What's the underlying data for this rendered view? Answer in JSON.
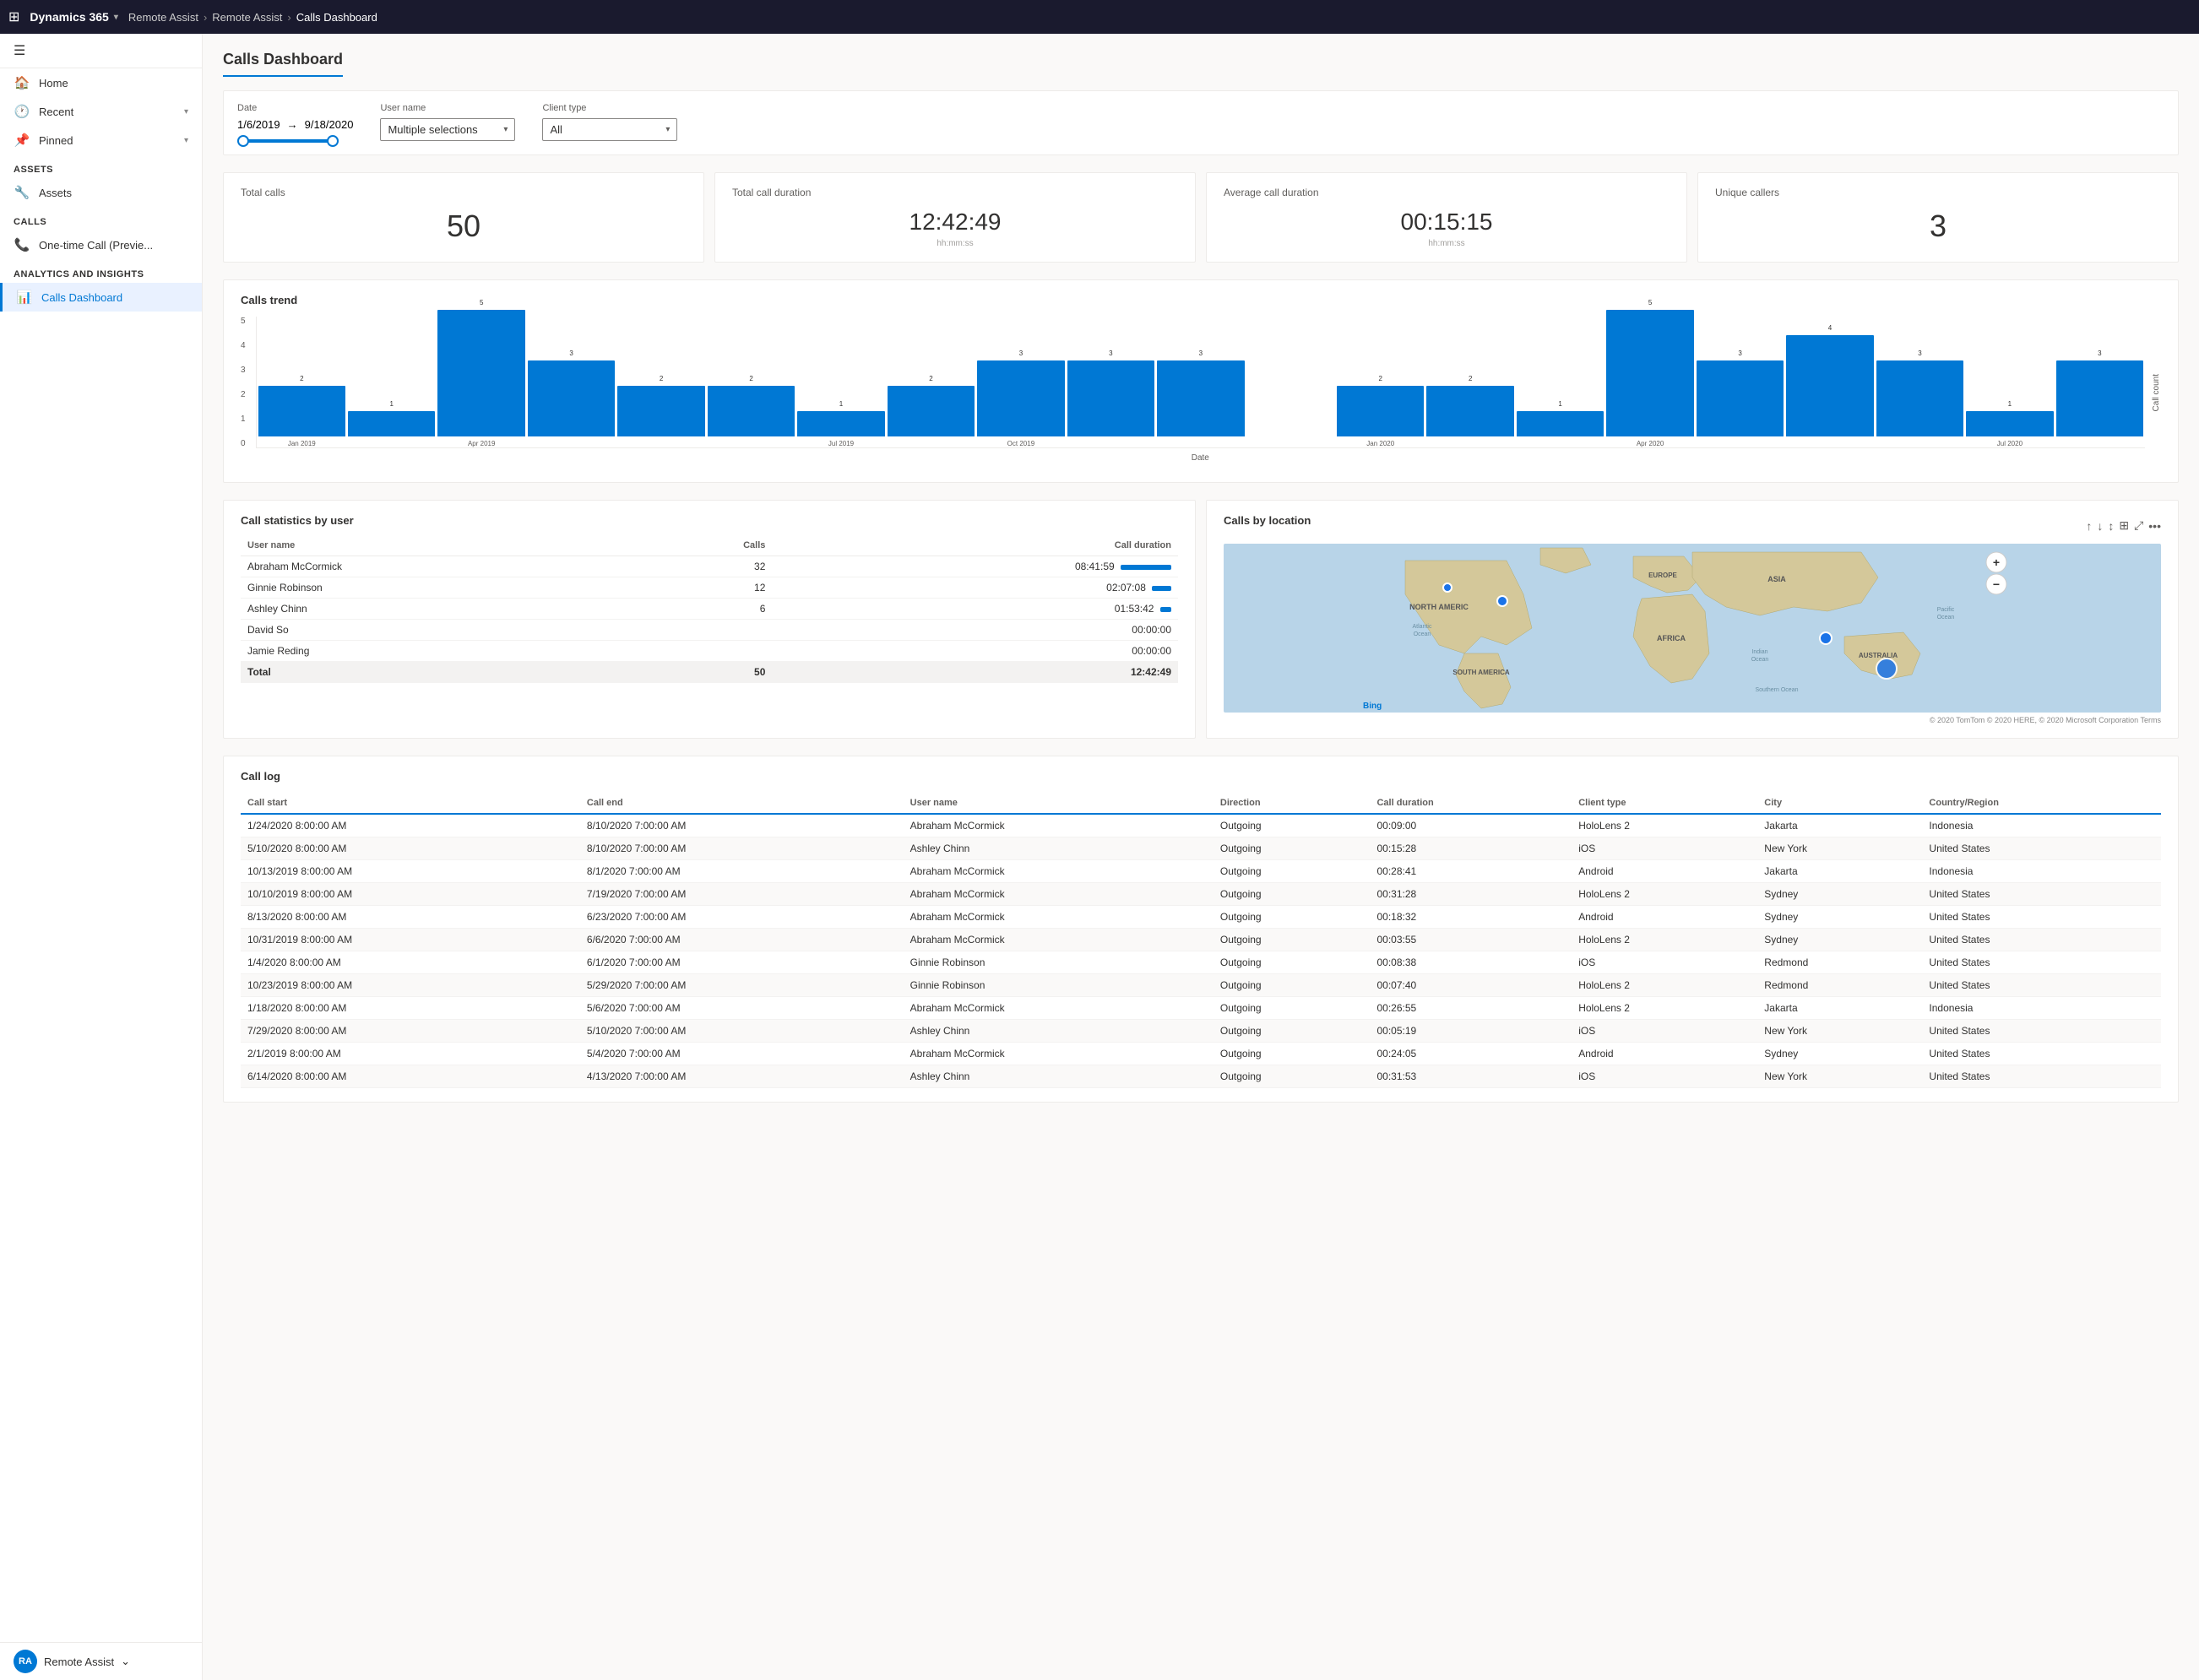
{
  "app": {
    "brand": "Dynamics 365",
    "module": "Remote Assist",
    "breadcrumb1": "Remote Assist",
    "breadcrumb2": "Calls Dashboard"
  },
  "topbar": {
    "waffle": "⊞"
  },
  "sidebar": {
    "hamburger": "☰",
    "items": [
      {
        "id": "home",
        "label": "Home",
        "icon": "🏠"
      },
      {
        "id": "recent",
        "label": "Recent",
        "icon": "🕐",
        "hasChevron": true
      },
      {
        "id": "pinned",
        "label": "Pinned",
        "icon": "📌",
        "hasChevron": true
      }
    ],
    "sections": [
      {
        "header": "Assets",
        "items": [
          {
            "id": "assets",
            "label": "Assets",
            "icon": "🔧"
          }
        ]
      },
      {
        "header": "Calls",
        "items": [
          {
            "id": "one-time-call",
            "label": "One-time Call (Previe...",
            "icon": "📞"
          }
        ]
      },
      {
        "header": "Analytics and Insights",
        "items": [
          {
            "id": "calls-dashboard",
            "label": "Calls Dashboard",
            "icon": "📊",
            "active": true
          }
        ]
      }
    ],
    "footer": {
      "initials": "RA",
      "label": "Remote Assist",
      "chevron": "⌄"
    }
  },
  "page": {
    "title": "Calls Dashboard"
  },
  "filters": {
    "date_label": "Date",
    "date_start": "1/6/2019",
    "date_end": "9/18/2020",
    "username_label": "User name",
    "username_value": "Multiple selections",
    "client_type_label": "Client type",
    "client_type_value": "All"
  },
  "kpis": [
    {
      "title": "Total calls",
      "value": "50",
      "subtitle": ""
    },
    {
      "title": "Total call duration",
      "value": "12:42:49",
      "subtitle": "hh:mm:ss"
    },
    {
      "title": "Average call duration",
      "value": "00:15:15",
      "subtitle": "hh:mm:ss"
    },
    {
      "title": "Unique callers",
      "value": "3",
      "subtitle": ""
    }
  ],
  "calls_trend": {
    "title": "Calls trend",
    "y_label": "Call count",
    "x_label": "Date",
    "y_ticks": [
      5,
      4,
      3,
      2,
      1,
      0
    ],
    "bars": [
      {
        "month": "Jan 2019",
        "value": 2
      },
      {
        "month": "",
        "value": 1
      },
      {
        "month": "Apr 2019",
        "value": 5
      },
      {
        "month": "",
        "value": 3
      },
      {
        "month": "",
        "value": 2
      },
      {
        "month": "",
        "value": 2
      },
      {
        "month": "Jul 2019",
        "value": 1
      },
      {
        "month": "",
        "value": 2
      },
      {
        "month": "Oct 2019",
        "value": 3
      },
      {
        "month": "",
        "value": 3
      },
      {
        "month": "",
        "value": 3
      },
      {
        "month": "",
        "value": 0
      },
      {
        "month": "Jan 2020",
        "value": 2
      },
      {
        "month": "",
        "value": 2
      },
      {
        "month": "",
        "value": 1
      },
      {
        "month": "Apr 2020",
        "value": 5
      },
      {
        "month": "",
        "value": 3
      },
      {
        "month": "",
        "value": 4
      },
      {
        "month": "",
        "value": 3
      },
      {
        "month": "Jul 2020",
        "value": 1
      },
      {
        "month": "",
        "value": 3
      }
    ]
  },
  "call_stats": {
    "title": "Call statistics by user",
    "columns": [
      "User name",
      "Calls",
      "Call duration"
    ],
    "rows": [
      {
        "name": "Abraham McCormick",
        "calls": 32,
        "duration": "08:41:59",
        "bar_pct": 100
      },
      {
        "name": "Ginnie Robinson",
        "calls": 12,
        "duration": "02:07:08",
        "bar_pct": 38
      },
      {
        "name": "Ashley Chinn",
        "calls": 6,
        "duration": "01:53:42",
        "bar_pct": 22
      },
      {
        "name": "David So",
        "calls": "",
        "duration": "00:00:00",
        "bar_pct": 0
      },
      {
        "name": "Jamie Reding",
        "calls": "",
        "duration": "00:00:00",
        "bar_pct": 0
      }
    ],
    "total_row": {
      "name": "Total",
      "calls": 50,
      "duration": "12:42:49"
    }
  },
  "calls_by_location": {
    "title": "Calls by location",
    "dots": [
      {
        "top": 48,
        "left": 77,
        "size": "large"
      },
      {
        "top": 60,
        "left": 52,
        "size": "small"
      },
      {
        "top": 55,
        "left": 88,
        "size": "small"
      }
    ],
    "labels": [
      {
        "text": "EUROPE",
        "top": 30,
        "left": 47
      },
      {
        "text": "ASIA",
        "top": 28,
        "left": 65
      },
      {
        "text": "NORTH AMERIC",
        "top": 28,
        "left": 82
      },
      {
        "text": "AFRICA",
        "top": 50,
        "left": 45
      },
      {
        "text": "SOUTH AMERICA",
        "top": 58,
        "left": 24
      },
      {
        "text": "AUSTRALIA",
        "top": 58,
        "left": 72
      },
      {
        "text": "Atlantic\nOcean",
        "top": 46,
        "left": 36
      },
      {
        "text": "Indian\nOcean",
        "top": 55,
        "left": 60
      },
      {
        "text": "Pacific\nOcean",
        "top": 43,
        "left": 88
      },
      {
        "text": "Southern Ocean",
        "top": 70,
        "left": 62
      }
    ],
    "footer": "© 2020 TomTom © 2020 HERE, © 2020 Microsoft Corporation Terms"
  },
  "call_log": {
    "title": "Call log",
    "columns": [
      "Call start",
      "Call end",
      "User name",
      "Direction",
      "Call duration",
      "Client type",
      "City",
      "Country/Region"
    ],
    "rows": [
      {
        "start": "1/24/2020 8:00:00 AM",
        "end": "8/10/2020 7:00:00 AM",
        "user": "Abraham McCormick",
        "dir": "Outgoing",
        "duration": "00:09:00",
        "client": "HoloLens 2",
        "city": "Jakarta",
        "country": "Indonesia"
      },
      {
        "start": "5/10/2020 8:00:00 AM",
        "end": "8/10/2020 7:00:00 AM",
        "user": "Ashley Chinn",
        "dir": "Outgoing",
        "duration": "00:15:28",
        "client": "iOS",
        "city": "New York",
        "country": "United States"
      },
      {
        "start": "10/13/2019 8:00:00 AM",
        "end": "8/1/2020 7:00:00 AM",
        "user": "Abraham McCormick",
        "dir": "Outgoing",
        "duration": "00:28:41",
        "client": "Android",
        "city": "Jakarta",
        "country": "Indonesia"
      },
      {
        "start": "10/10/2019 8:00:00 AM",
        "end": "7/19/2020 7:00:00 AM",
        "user": "Abraham McCormick",
        "dir": "Outgoing",
        "duration": "00:31:28",
        "client": "HoloLens 2",
        "city": "Sydney",
        "country": "United States"
      },
      {
        "start": "8/13/2020 8:00:00 AM",
        "end": "6/23/2020 7:00:00 AM",
        "user": "Abraham McCormick",
        "dir": "Outgoing",
        "duration": "00:18:32",
        "client": "Android",
        "city": "Sydney",
        "country": "United States"
      },
      {
        "start": "10/31/2019 8:00:00 AM",
        "end": "6/6/2020 7:00:00 AM",
        "user": "Abraham McCormick",
        "dir": "Outgoing",
        "duration": "00:03:55",
        "client": "HoloLens 2",
        "city": "Sydney",
        "country": "United States"
      },
      {
        "start": "1/4/2020 8:00:00 AM",
        "end": "6/1/2020 7:00:00 AM",
        "user": "Ginnie Robinson",
        "dir": "Outgoing",
        "duration": "00:08:38",
        "client": "iOS",
        "city": "Redmond",
        "country": "United States"
      },
      {
        "start": "10/23/2019 8:00:00 AM",
        "end": "5/29/2020 7:00:00 AM",
        "user": "Ginnie Robinson",
        "dir": "Outgoing",
        "duration": "00:07:40",
        "client": "HoloLens 2",
        "city": "Redmond",
        "country": "United States"
      },
      {
        "start": "1/18/2020 8:00:00 AM",
        "end": "5/6/2020 7:00:00 AM",
        "user": "Abraham McCormick",
        "dir": "Outgoing",
        "duration": "00:26:55",
        "client": "HoloLens 2",
        "city": "Jakarta",
        "country": "Indonesia"
      },
      {
        "start": "7/29/2020 8:00:00 AM",
        "end": "5/10/2020 7:00:00 AM",
        "user": "Ashley Chinn",
        "dir": "Outgoing",
        "duration": "00:05:19",
        "client": "iOS",
        "city": "New York",
        "country": "United States"
      },
      {
        "start": "2/1/2019 8:00:00 AM",
        "end": "5/4/2020 7:00:00 AM",
        "user": "Abraham McCormick",
        "dir": "Outgoing",
        "duration": "00:24:05",
        "client": "Android",
        "city": "Sydney",
        "country": "United States"
      },
      {
        "start": "6/14/2020 8:00:00 AM",
        "end": "4/13/2020 7:00:00 AM",
        "user": "Ashley Chinn",
        "dir": "Outgoing",
        "duration": "00:31:53",
        "client": "iOS",
        "city": "New York",
        "country": "United States"
      }
    ]
  }
}
